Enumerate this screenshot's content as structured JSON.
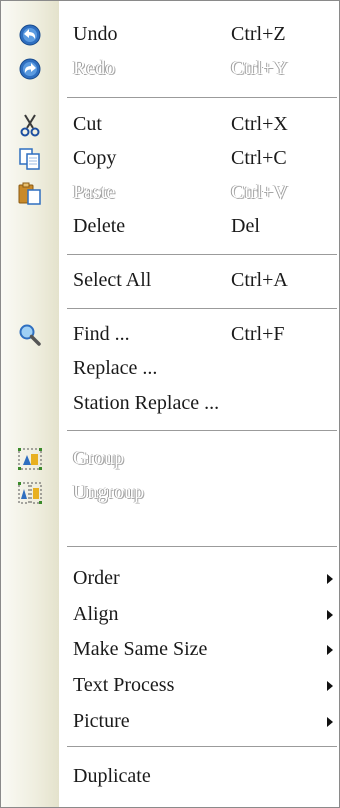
{
  "menu": {
    "undo": {
      "label": "Undo",
      "shortcut": "Ctrl+Z",
      "icon": "undo-icon"
    },
    "redo": {
      "label": "Redo",
      "shortcut": "Ctrl+Y",
      "icon": "redo-icon"
    },
    "cut": {
      "label": "Cut",
      "shortcut": "Ctrl+X",
      "icon": "scissors-icon"
    },
    "copy": {
      "label": "Copy",
      "shortcut": "Ctrl+C",
      "icon": "copy-icon"
    },
    "paste": {
      "label": "Paste",
      "shortcut": "Ctrl+V",
      "icon": "paste-icon"
    },
    "delete": {
      "label": "Delete",
      "shortcut": "Del"
    },
    "select_all": {
      "label": "Select All",
      "shortcut": "Ctrl+A"
    },
    "find": {
      "label": "Find ...",
      "shortcut": "Ctrl+F",
      "icon": "magnifier-icon"
    },
    "replace": {
      "label": "Replace ..."
    },
    "station_replace": {
      "label": "Station Replace ..."
    },
    "group": {
      "label": "Group",
      "icon": "group-icon"
    },
    "ungroup": {
      "label": "Ungroup",
      "icon": "ungroup-icon"
    },
    "order": {
      "label": "Order"
    },
    "align": {
      "label": "Align"
    },
    "make_same_size": {
      "label": "Make Same Size"
    },
    "text_process": {
      "label": "Text Process"
    },
    "picture": {
      "label": "Picture"
    },
    "duplicate": {
      "label": "Duplicate"
    }
  },
  "colors": {
    "text": "#1a1a1a",
    "disabled_shadow": "#a6a6a6",
    "separator": "#9b9b9b",
    "gutter": "#efeedf",
    "undo_blue": "#2f6fc0"
  }
}
